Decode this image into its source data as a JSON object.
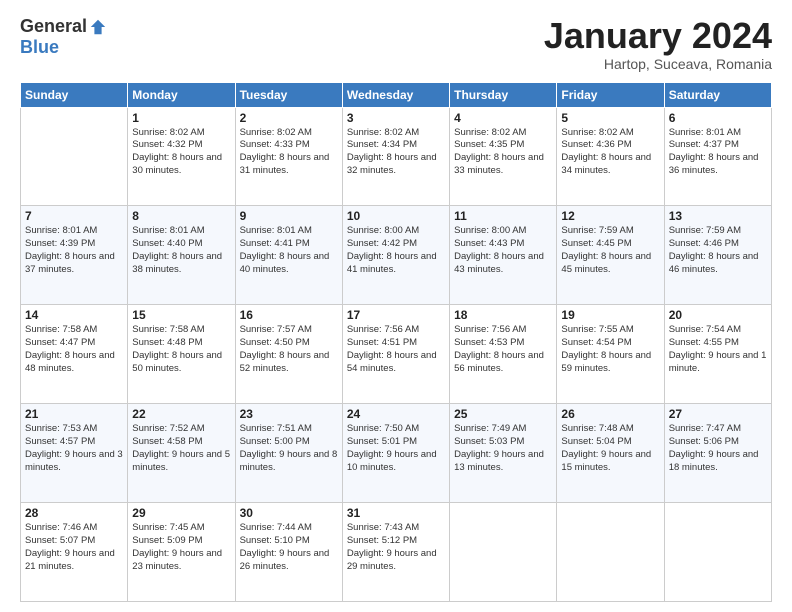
{
  "header": {
    "logo_general": "General",
    "logo_blue": "Blue",
    "title": "January 2024",
    "subtitle": "Hartop, Suceava, Romania"
  },
  "days_of_week": [
    "Sunday",
    "Monday",
    "Tuesday",
    "Wednesday",
    "Thursday",
    "Friday",
    "Saturday"
  ],
  "weeks": [
    [
      {
        "day": "",
        "sunrise": "",
        "sunset": "",
        "daylight": ""
      },
      {
        "day": "1",
        "sunrise": "Sunrise: 8:02 AM",
        "sunset": "Sunset: 4:32 PM",
        "daylight": "Daylight: 8 hours and 30 minutes."
      },
      {
        "day": "2",
        "sunrise": "Sunrise: 8:02 AM",
        "sunset": "Sunset: 4:33 PM",
        "daylight": "Daylight: 8 hours and 31 minutes."
      },
      {
        "day": "3",
        "sunrise": "Sunrise: 8:02 AM",
        "sunset": "Sunset: 4:34 PM",
        "daylight": "Daylight: 8 hours and 32 minutes."
      },
      {
        "day": "4",
        "sunrise": "Sunrise: 8:02 AM",
        "sunset": "Sunset: 4:35 PM",
        "daylight": "Daylight: 8 hours and 33 minutes."
      },
      {
        "day": "5",
        "sunrise": "Sunrise: 8:02 AM",
        "sunset": "Sunset: 4:36 PM",
        "daylight": "Daylight: 8 hours and 34 minutes."
      },
      {
        "day": "6",
        "sunrise": "Sunrise: 8:01 AM",
        "sunset": "Sunset: 4:37 PM",
        "daylight": "Daylight: 8 hours and 36 minutes."
      }
    ],
    [
      {
        "day": "7",
        "sunrise": "Sunrise: 8:01 AM",
        "sunset": "Sunset: 4:39 PM",
        "daylight": "Daylight: 8 hours and 37 minutes."
      },
      {
        "day": "8",
        "sunrise": "Sunrise: 8:01 AM",
        "sunset": "Sunset: 4:40 PM",
        "daylight": "Daylight: 8 hours and 38 minutes."
      },
      {
        "day": "9",
        "sunrise": "Sunrise: 8:01 AM",
        "sunset": "Sunset: 4:41 PM",
        "daylight": "Daylight: 8 hours and 40 minutes."
      },
      {
        "day": "10",
        "sunrise": "Sunrise: 8:00 AM",
        "sunset": "Sunset: 4:42 PM",
        "daylight": "Daylight: 8 hours and 41 minutes."
      },
      {
        "day": "11",
        "sunrise": "Sunrise: 8:00 AM",
        "sunset": "Sunset: 4:43 PM",
        "daylight": "Daylight: 8 hours and 43 minutes."
      },
      {
        "day": "12",
        "sunrise": "Sunrise: 7:59 AM",
        "sunset": "Sunset: 4:45 PM",
        "daylight": "Daylight: 8 hours and 45 minutes."
      },
      {
        "day": "13",
        "sunrise": "Sunrise: 7:59 AM",
        "sunset": "Sunset: 4:46 PM",
        "daylight": "Daylight: 8 hours and 46 minutes."
      }
    ],
    [
      {
        "day": "14",
        "sunrise": "Sunrise: 7:58 AM",
        "sunset": "Sunset: 4:47 PM",
        "daylight": "Daylight: 8 hours and 48 minutes."
      },
      {
        "day": "15",
        "sunrise": "Sunrise: 7:58 AM",
        "sunset": "Sunset: 4:48 PM",
        "daylight": "Daylight: 8 hours and 50 minutes."
      },
      {
        "day": "16",
        "sunrise": "Sunrise: 7:57 AM",
        "sunset": "Sunset: 4:50 PM",
        "daylight": "Daylight: 8 hours and 52 minutes."
      },
      {
        "day": "17",
        "sunrise": "Sunrise: 7:56 AM",
        "sunset": "Sunset: 4:51 PM",
        "daylight": "Daylight: 8 hours and 54 minutes."
      },
      {
        "day": "18",
        "sunrise": "Sunrise: 7:56 AM",
        "sunset": "Sunset: 4:53 PM",
        "daylight": "Daylight: 8 hours and 56 minutes."
      },
      {
        "day": "19",
        "sunrise": "Sunrise: 7:55 AM",
        "sunset": "Sunset: 4:54 PM",
        "daylight": "Daylight: 8 hours and 59 minutes."
      },
      {
        "day": "20",
        "sunrise": "Sunrise: 7:54 AM",
        "sunset": "Sunset: 4:55 PM",
        "daylight": "Daylight: 9 hours and 1 minute."
      }
    ],
    [
      {
        "day": "21",
        "sunrise": "Sunrise: 7:53 AM",
        "sunset": "Sunset: 4:57 PM",
        "daylight": "Daylight: 9 hours and 3 minutes."
      },
      {
        "day": "22",
        "sunrise": "Sunrise: 7:52 AM",
        "sunset": "Sunset: 4:58 PM",
        "daylight": "Daylight: 9 hours and 5 minutes."
      },
      {
        "day": "23",
        "sunrise": "Sunrise: 7:51 AM",
        "sunset": "Sunset: 5:00 PM",
        "daylight": "Daylight: 9 hours and 8 minutes."
      },
      {
        "day": "24",
        "sunrise": "Sunrise: 7:50 AM",
        "sunset": "Sunset: 5:01 PM",
        "daylight": "Daylight: 9 hours and 10 minutes."
      },
      {
        "day": "25",
        "sunrise": "Sunrise: 7:49 AM",
        "sunset": "Sunset: 5:03 PM",
        "daylight": "Daylight: 9 hours and 13 minutes."
      },
      {
        "day": "26",
        "sunrise": "Sunrise: 7:48 AM",
        "sunset": "Sunset: 5:04 PM",
        "daylight": "Daylight: 9 hours and 15 minutes."
      },
      {
        "day": "27",
        "sunrise": "Sunrise: 7:47 AM",
        "sunset": "Sunset: 5:06 PM",
        "daylight": "Daylight: 9 hours and 18 minutes."
      }
    ],
    [
      {
        "day": "28",
        "sunrise": "Sunrise: 7:46 AM",
        "sunset": "Sunset: 5:07 PM",
        "daylight": "Daylight: 9 hours and 21 minutes."
      },
      {
        "day": "29",
        "sunrise": "Sunrise: 7:45 AM",
        "sunset": "Sunset: 5:09 PM",
        "daylight": "Daylight: 9 hours and 23 minutes."
      },
      {
        "day": "30",
        "sunrise": "Sunrise: 7:44 AM",
        "sunset": "Sunset: 5:10 PM",
        "daylight": "Daylight: 9 hours and 26 minutes."
      },
      {
        "day": "31",
        "sunrise": "Sunrise: 7:43 AM",
        "sunset": "Sunset: 5:12 PM",
        "daylight": "Daylight: 9 hours and 29 minutes."
      },
      {
        "day": "",
        "sunrise": "",
        "sunset": "",
        "daylight": ""
      },
      {
        "day": "",
        "sunrise": "",
        "sunset": "",
        "daylight": ""
      },
      {
        "day": "",
        "sunrise": "",
        "sunset": "",
        "daylight": ""
      }
    ]
  ]
}
